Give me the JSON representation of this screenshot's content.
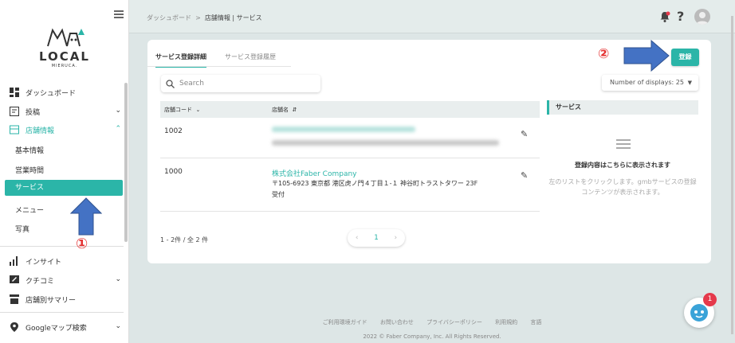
{
  "sidebar": {
    "logo_main": "LOCAL",
    "logo_sub": "MIERUCA.",
    "items": [
      {
        "label": "ダッシュボード"
      },
      {
        "label": "投稿"
      },
      {
        "label": "店舗情報"
      },
      {
        "label": "インサイト"
      },
      {
        "label": "クチコミ"
      },
      {
        "label": "店舗別サマリー"
      },
      {
        "label": "Googleマップ検索"
      }
    ],
    "sub_items": [
      "基本情報",
      "営業時間",
      "サービス",
      "メニュー",
      "写真"
    ]
  },
  "header": {
    "crumb_home": "ダッシュボード",
    "crumb_sep": ">",
    "crumb_current": "店舗情報 | サービス"
  },
  "tabs": [
    "サービス登録詳細",
    "サービス登録履歴"
  ],
  "search": {
    "placeholder": "Search"
  },
  "register_label": "登録",
  "display": {
    "label": "Number of displays: 25"
  },
  "table": {
    "col_code": "店舗コード",
    "col_name": "店舗名",
    "rows": [
      {
        "code": "1002",
        "name": "",
        "address": ""
      },
      {
        "code": "1000",
        "name": "株式会社Faber Company",
        "address": "〒105-6923 東京都 港区虎ノ門４丁目１-１ 神谷町トラストタワー 23F 受付"
      }
    ]
  },
  "pagination": {
    "count": "1 - 2件 / 全 2 件",
    "page": "1",
    "prev": "‹",
    "next": "›"
  },
  "service_panel": {
    "title": "サービス",
    "empty_title": "登録内容はこちらに表示されます",
    "empty_desc": "左のリストをクリックします。gmbサービスの登録コンテンツが表示されます。"
  },
  "annotations": {
    "one": "①",
    "two": "②"
  },
  "footer": {
    "links": [
      "ご利用環境ガイド",
      "お問い合わせ",
      "プライバシーポリシー",
      "利用規約",
      "言語"
    ],
    "copyright": "2022 © Faber Company, Inc. All Rights Reserved."
  },
  "chat_badge": "1",
  "colors": {
    "accent": "#2bb5a8",
    "annotation": "#e53333",
    "arrow": "#4472c4"
  }
}
